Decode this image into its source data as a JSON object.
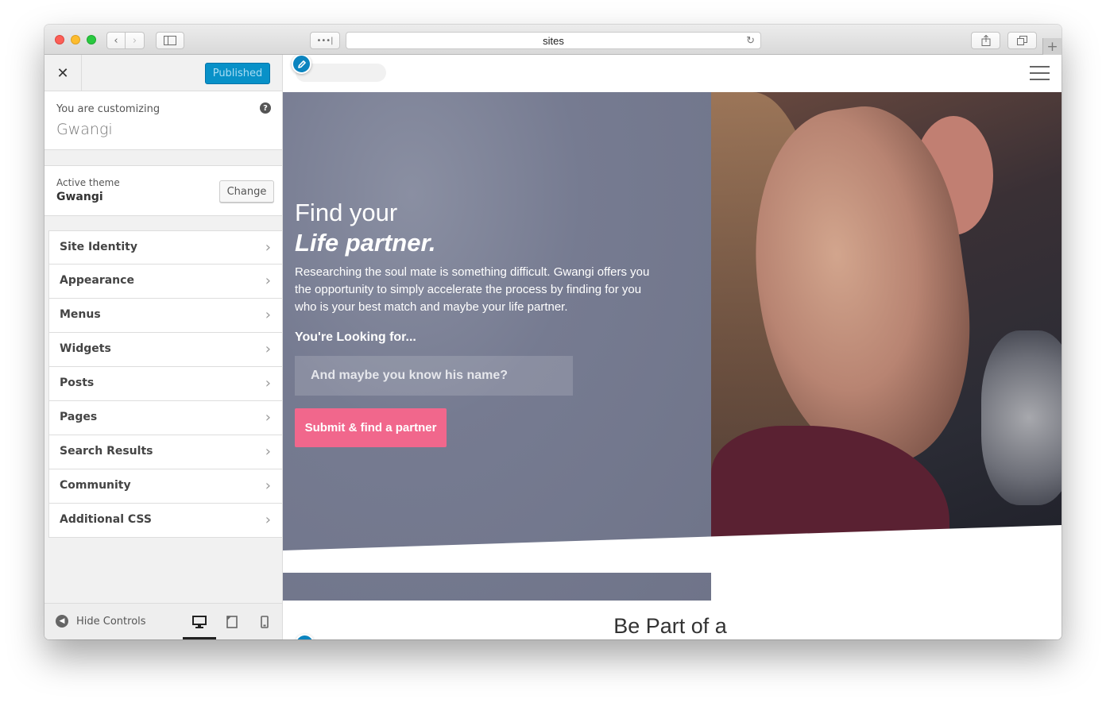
{
  "browser": {
    "url_text": "sites",
    "dots_label": "•••|",
    "new_tab_label": "+"
  },
  "sidebar": {
    "publish_label": "Published",
    "customizing_label": "You are customizing",
    "site_name": "Gwangi",
    "help_label": "?",
    "active_theme_label": "Active theme",
    "theme_name": "Gwangi",
    "change_label": "Change",
    "items": [
      {
        "label": "Site Identity"
      },
      {
        "label": "Appearance"
      },
      {
        "label": "Menus"
      },
      {
        "label": "Widgets"
      },
      {
        "label": "Posts"
      },
      {
        "label": "Pages"
      },
      {
        "label": "Search Results"
      },
      {
        "label": "Community"
      },
      {
        "label": "Additional CSS"
      }
    ],
    "hide_controls_label": "Hide Controls"
  },
  "preview": {
    "headline_line1": "Find your",
    "headline_line2": "Life partner.",
    "description": "Researching the soul mate is something difficult. Gwangi offers you the opportunity to simply accelerate the process by finding for you who is your best match and maybe your life partner.",
    "looking_label": "You're Looking for...",
    "input_placeholder": "And maybe you know his name?",
    "submit_label": "Submit & find a partner",
    "section_title": "Be Part of a"
  },
  "colors": {
    "publish_button": "#0891c8",
    "submit_button": "#f1678c",
    "edit_pencil": "#0b84bf"
  },
  "icons": [
    "close-icon",
    "help-icon",
    "chevron-right-icon",
    "hide-controls-icon",
    "desktop-icon",
    "tablet-icon",
    "mobile-icon",
    "pencil-icon",
    "hamburger-menu-icon",
    "back-icon",
    "forward-icon",
    "sidebar-toggle-icon",
    "reload-icon",
    "share-icon",
    "tabs-icon"
  ]
}
